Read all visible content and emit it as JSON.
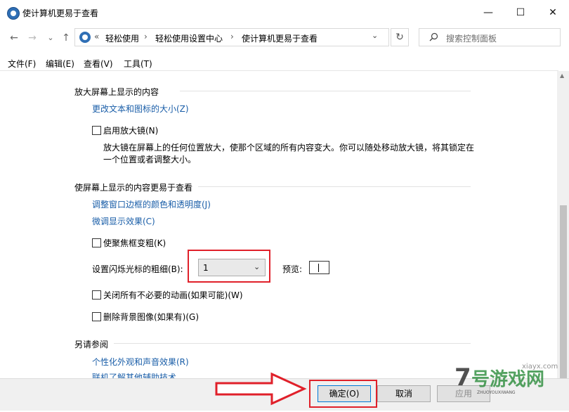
{
  "window": {
    "title": "使计算机更易于查看"
  },
  "titlebar_buttons": {
    "minimize": "—",
    "maximize": "☐",
    "close": "✕"
  },
  "nav": {
    "back": "←",
    "forward": "→",
    "dropdown": "⌄",
    "up": "↑"
  },
  "address": {
    "prefix": "«",
    "crumbs": [
      "轻松使用",
      "轻松使用设置中心",
      "使计算机更易于查看"
    ],
    "separator": "›",
    "dropdown": "⌄",
    "refresh": "↻"
  },
  "search": {
    "placeholder": "搜索控制面板",
    "icon": "search-icon"
  },
  "menu": [
    "文件(F)",
    "编辑(E)",
    "查看(V)",
    "工具(T)"
  ],
  "sections": {
    "magnify": {
      "title": "放大屏幕上显示的内容",
      "link": "更改文本和图标的大小(Z)",
      "checkbox": "启用放大镜(N)",
      "description_line1": "放大镜在屏幕上的任何位置放大，使那个区域的所有内容变大。你可以随处移动放大镜，将其锁定在",
      "description_line2": "一个位置或者调整大小。"
    },
    "easier": {
      "title": "使屏幕上显示的内容更易于查看",
      "link1": "调整窗口边框的颜色和透明度(J)",
      "link2": "微调显示效果(C)",
      "focus_checkbox": "使聚焦框变粗(K)",
      "cursor_label": "设置闪烁光标的粗细(B):",
      "cursor_value": "1",
      "preview_label": "预览:",
      "animation_checkbox": "关闭所有不必要的动画(如果可能)(W)",
      "background_checkbox": "删除背景图像(如果有)(G)"
    },
    "see_also": {
      "title": "另请参阅",
      "link1": "个性化外观和声音效果(R)",
      "link2": "联机了解其他辅助技术"
    }
  },
  "buttons": {
    "ok": "确定(O)",
    "cancel": "取消",
    "apply": "应用"
  },
  "watermark": {
    "brand": "7号游戏网",
    "latin": "ZHUOYOUXIWANG",
    "site": "xiayx.com"
  },
  "colors": {
    "link": "#1a5ea8",
    "highlight": "#e0202a",
    "accent": "#0078d7"
  }
}
